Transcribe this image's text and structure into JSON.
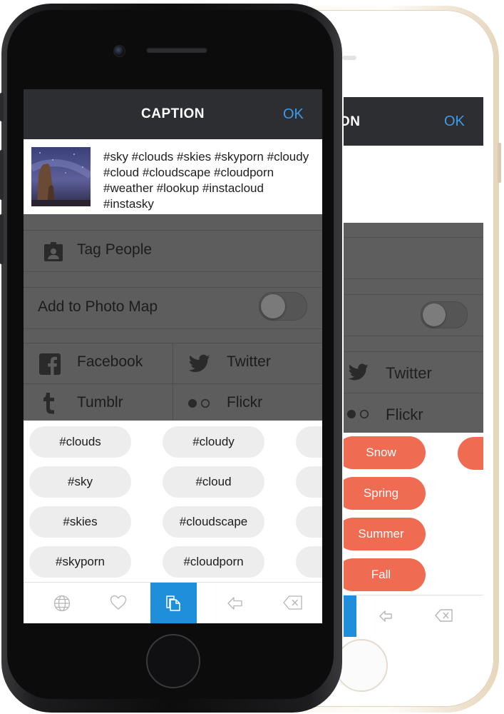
{
  "front_screen": {
    "header": {
      "title": "CAPTION",
      "ok_label": "OK"
    },
    "caption": {
      "text": "#sky #clouds #skies #skyporn #cloudy #cloud #cloudscape #cloudporn #weather #lookup #instacloud #instasky"
    },
    "tag_people_label": "Tag People",
    "add_to_photo_map_label": "Add to Photo Map",
    "photo_map_enabled": false,
    "share": {
      "facebook": "Facebook",
      "twitter": "Twitter",
      "tumblr": "Tumblr",
      "flickr": "Flickr"
    },
    "hashtags": {
      "col1": [
        "#clouds",
        "#sky",
        "#skies",
        "#skyporn"
      ],
      "col2": [
        "#cloudy",
        "#cloud",
        "#cloudscape",
        "#cloudporn"
      ]
    },
    "bottom_bar": {
      "items": [
        "globe-icon",
        "heart-icon",
        "copy-icon",
        "back-arrow-icon",
        "delete-icon"
      ],
      "active_item": "copy-icon",
      "active_color": "#1f8fdc"
    }
  },
  "back_screen": {
    "header": {
      "title_partial": "ON",
      "ok_label": "OK"
    },
    "share": {
      "twitter": "Twitter",
      "flickr": "Flickr"
    },
    "categories": [
      "Snow",
      "Spring",
      "Summer",
      "Fall"
    ],
    "accent_color": "#ef6c53"
  }
}
